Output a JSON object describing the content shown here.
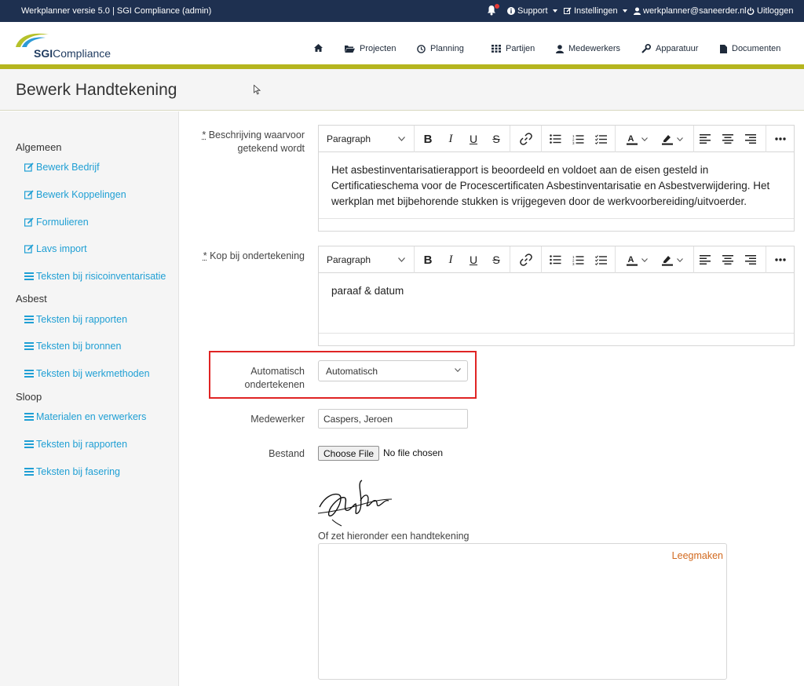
{
  "topbar": {
    "app_title": "Werkplanner versie 5.0 | SGI Compliance (admin)",
    "support": "Support",
    "settings": "Instellingen",
    "user": "werkplanner@saneerder.nl",
    "logout": "Uitloggen"
  },
  "logo": {
    "bold": "SGI",
    "rest": "Compliance"
  },
  "nav": {
    "projecten": "Projecten",
    "planning": "Planning",
    "partijen": "Partijen",
    "medewerkers": "Medewerkers",
    "apparatuur": "Apparatuur",
    "documenten": "Documenten"
  },
  "page": {
    "title": "Bewerk Handtekening"
  },
  "sidebar": {
    "algemeen": "Algemeen",
    "bewerk_bedrijf": "Bewerk Bedrijf",
    "bewerk_koppelingen": "Bewerk Koppelingen",
    "formulieren": "Formulieren",
    "lavs_import": "Lavs import",
    "teksten_risico": "Teksten bij risicoinventarisatie",
    "asbest": "Asbest",
    "teksten_rapporten": "Teksten bij rapporten",
    "teksten_bronnen": "Teksten bij bronnen",
    "teksten_werkmethoden": "Teksten bij werkmethoden",
    "sloop": "Sloop",
    "materialen": "Materialen en verwerkers",
    "teksten_rapporten_sloop": "Teksten bij rapporten",
    "teksten_fasering": "Teksten bij fasering"
  },
  "form": {
    "required_mark": "*",
    "description_label": "Beschrijving waarvoor getekend wordt",
    "description_value": "Het asbestinventarisatierapport is beoordeeld en voldoet aan de eisen gesteld in Certificatieschema voor de Procescertificaten Asbestinventarisatie en Asbestverwijdering. Het werkplan met bijbehorende stukken is vrijgegeven door de werkvoorbereiding/uitvoerder.",
    "heading_label": "Kop bij ondertekening",
    "heading_value": "paraaf & datum",
    "paragraph_style": "Paragraph",
    "auto_sign_label": "Automatisch ondertekenen",
    "auto_sign_value": "Automatisch",
    "employee_label": "Medewerker",
    "employee_value": "Caspers, Jeroen",
    "file_label": "Bestand",
    "file_button": "Choose File",
    "file_status": "No file chosen",
    "signature_caption": "Of zet hieronder een handtekening",
    "clear_link": "Leegmaken"
  },
  "colors": {
    "topbar": "#1e3050",
    "accent_bar": "#b5b51e",
    "sidebar_link": "#1f9fd4",
    "highlight": "#e02424",
    "clear_link": "#d2691e"
  }
}
